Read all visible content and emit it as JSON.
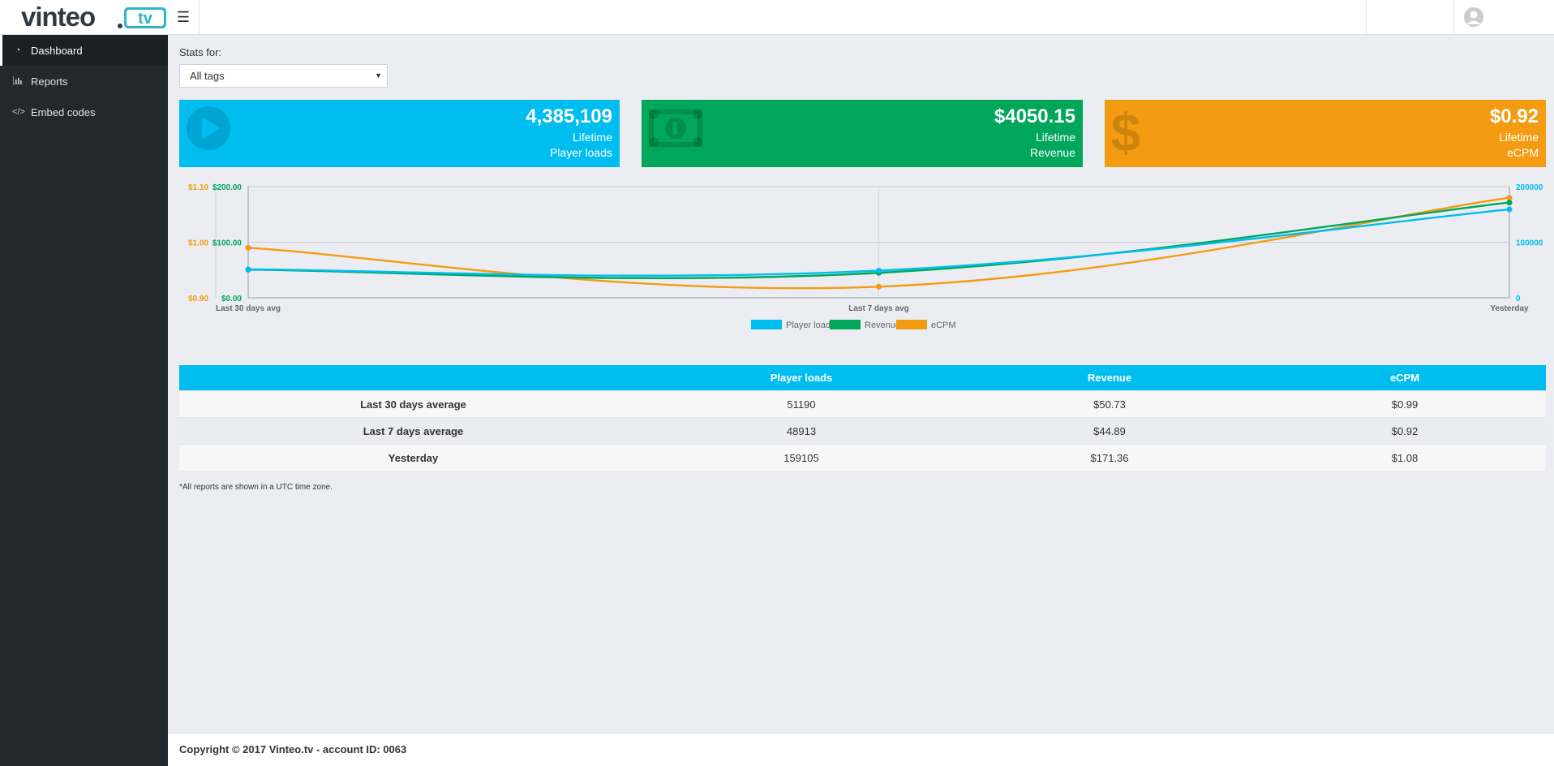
{
  "brand": {
    "name": "vinteo",
    "tv": "tv"
  },
  "sidebar": {
    "items": [
      {
        "label": "Dashboard",
        "icon": "dashboard-icon",
        "active": true
      },
      {
        "label": "Reports",
        "icon": "bar-chart-icon",
        "active": false
      },
      {
        "label": "Embed codes",
        "icon": "code-icon",
        "active": false
      }
    ]
  },
  "filter": {
    "label": "Stats for:",
    "selected": "All tags"
  },
  "cards": [
    {
      "value": "4,385,109",
      "line1": "Lifetime",
      "line2": "Player loads",
      "color": "#00bdf0",
      "icon": "play-icon"
    },
    {
      "value": "$4050.15",
      "line1": "Lifetime",
      "line2": "Revenue",
      "color": "#00a65a",
      "icon": "money-icon"
    },
    {
      "value": "$0.92",
      "line1": "Lifetime",
      "line2": "eCPM",
      "color": "#f39c12",
      "icon": "dollar-icon"
    }
  ],
  "chart_data": {
    "type": "line",
    "categories": [
      "Last 30 days avg",
      "Last 7 days avg",
      "Yesterday"
    ],
    "series": [
      {
        "name": "Player loads",
        "values": [
          51190,
          48913,
          159105
        ],
        "color": "#00bdf0",
        "axis": "right"
      },
      {
        "name": "Revenue",
        "values": [
          50.73,
          44.89,
          171.36
        ],
        "color": "#00a65a",
        "axis": "left-inner"
      },
      {
        "name": "eCPM",
        "values": [
          0.99,
          0.92,
          1.08
        ],
        "color": "#f39c12",
        "axis": "left-outer"
      }
    ],
    "axes": {
      "ecpm": {
        "ticks": [
          "$0.90",
          "$1.00",
          "$1.10"
        ],
        "range": [
          0.9,
          1.1
        ],
        "color": "#f39c12"
      },
      "revenue": {
        "ticks": [
          "$0.00",
          "$100.00",
          "$200.00"
        ],
        "range": [
          0,
          200
        ],
        "color": "#00a65a"
      },
      "loads": {
        "ticks": [
          "0",
          "100000",
          "200000"
        ],
        "range": [
          0,
          200000
        ],
        "color": "#00bdf0"
      }
    },
    "legend_position": "bottom",
    "grid": true
  },
  "table": {
    "headers": [
      "",
      "Player loads",
      "Revenue",
      "eCPM"
    ],
    "rows": [
      [
        "Last 30 days average",
        "51190",
        "$50.73",
        "$0.99"
      ],
      [
        "Last 7 days average",
        "48913",
        "$44.89",
        "$0.92"
      ],
      [
        "Yesterday",
        "159105",
        "$171.36",
        "$1.08"
      ]
    ]
  },
  "note": "*All reports are shown in a UTC time zone.",
  "footer": "Copyright © 2017 Vinteo.tv - account ID: 0063"
}
